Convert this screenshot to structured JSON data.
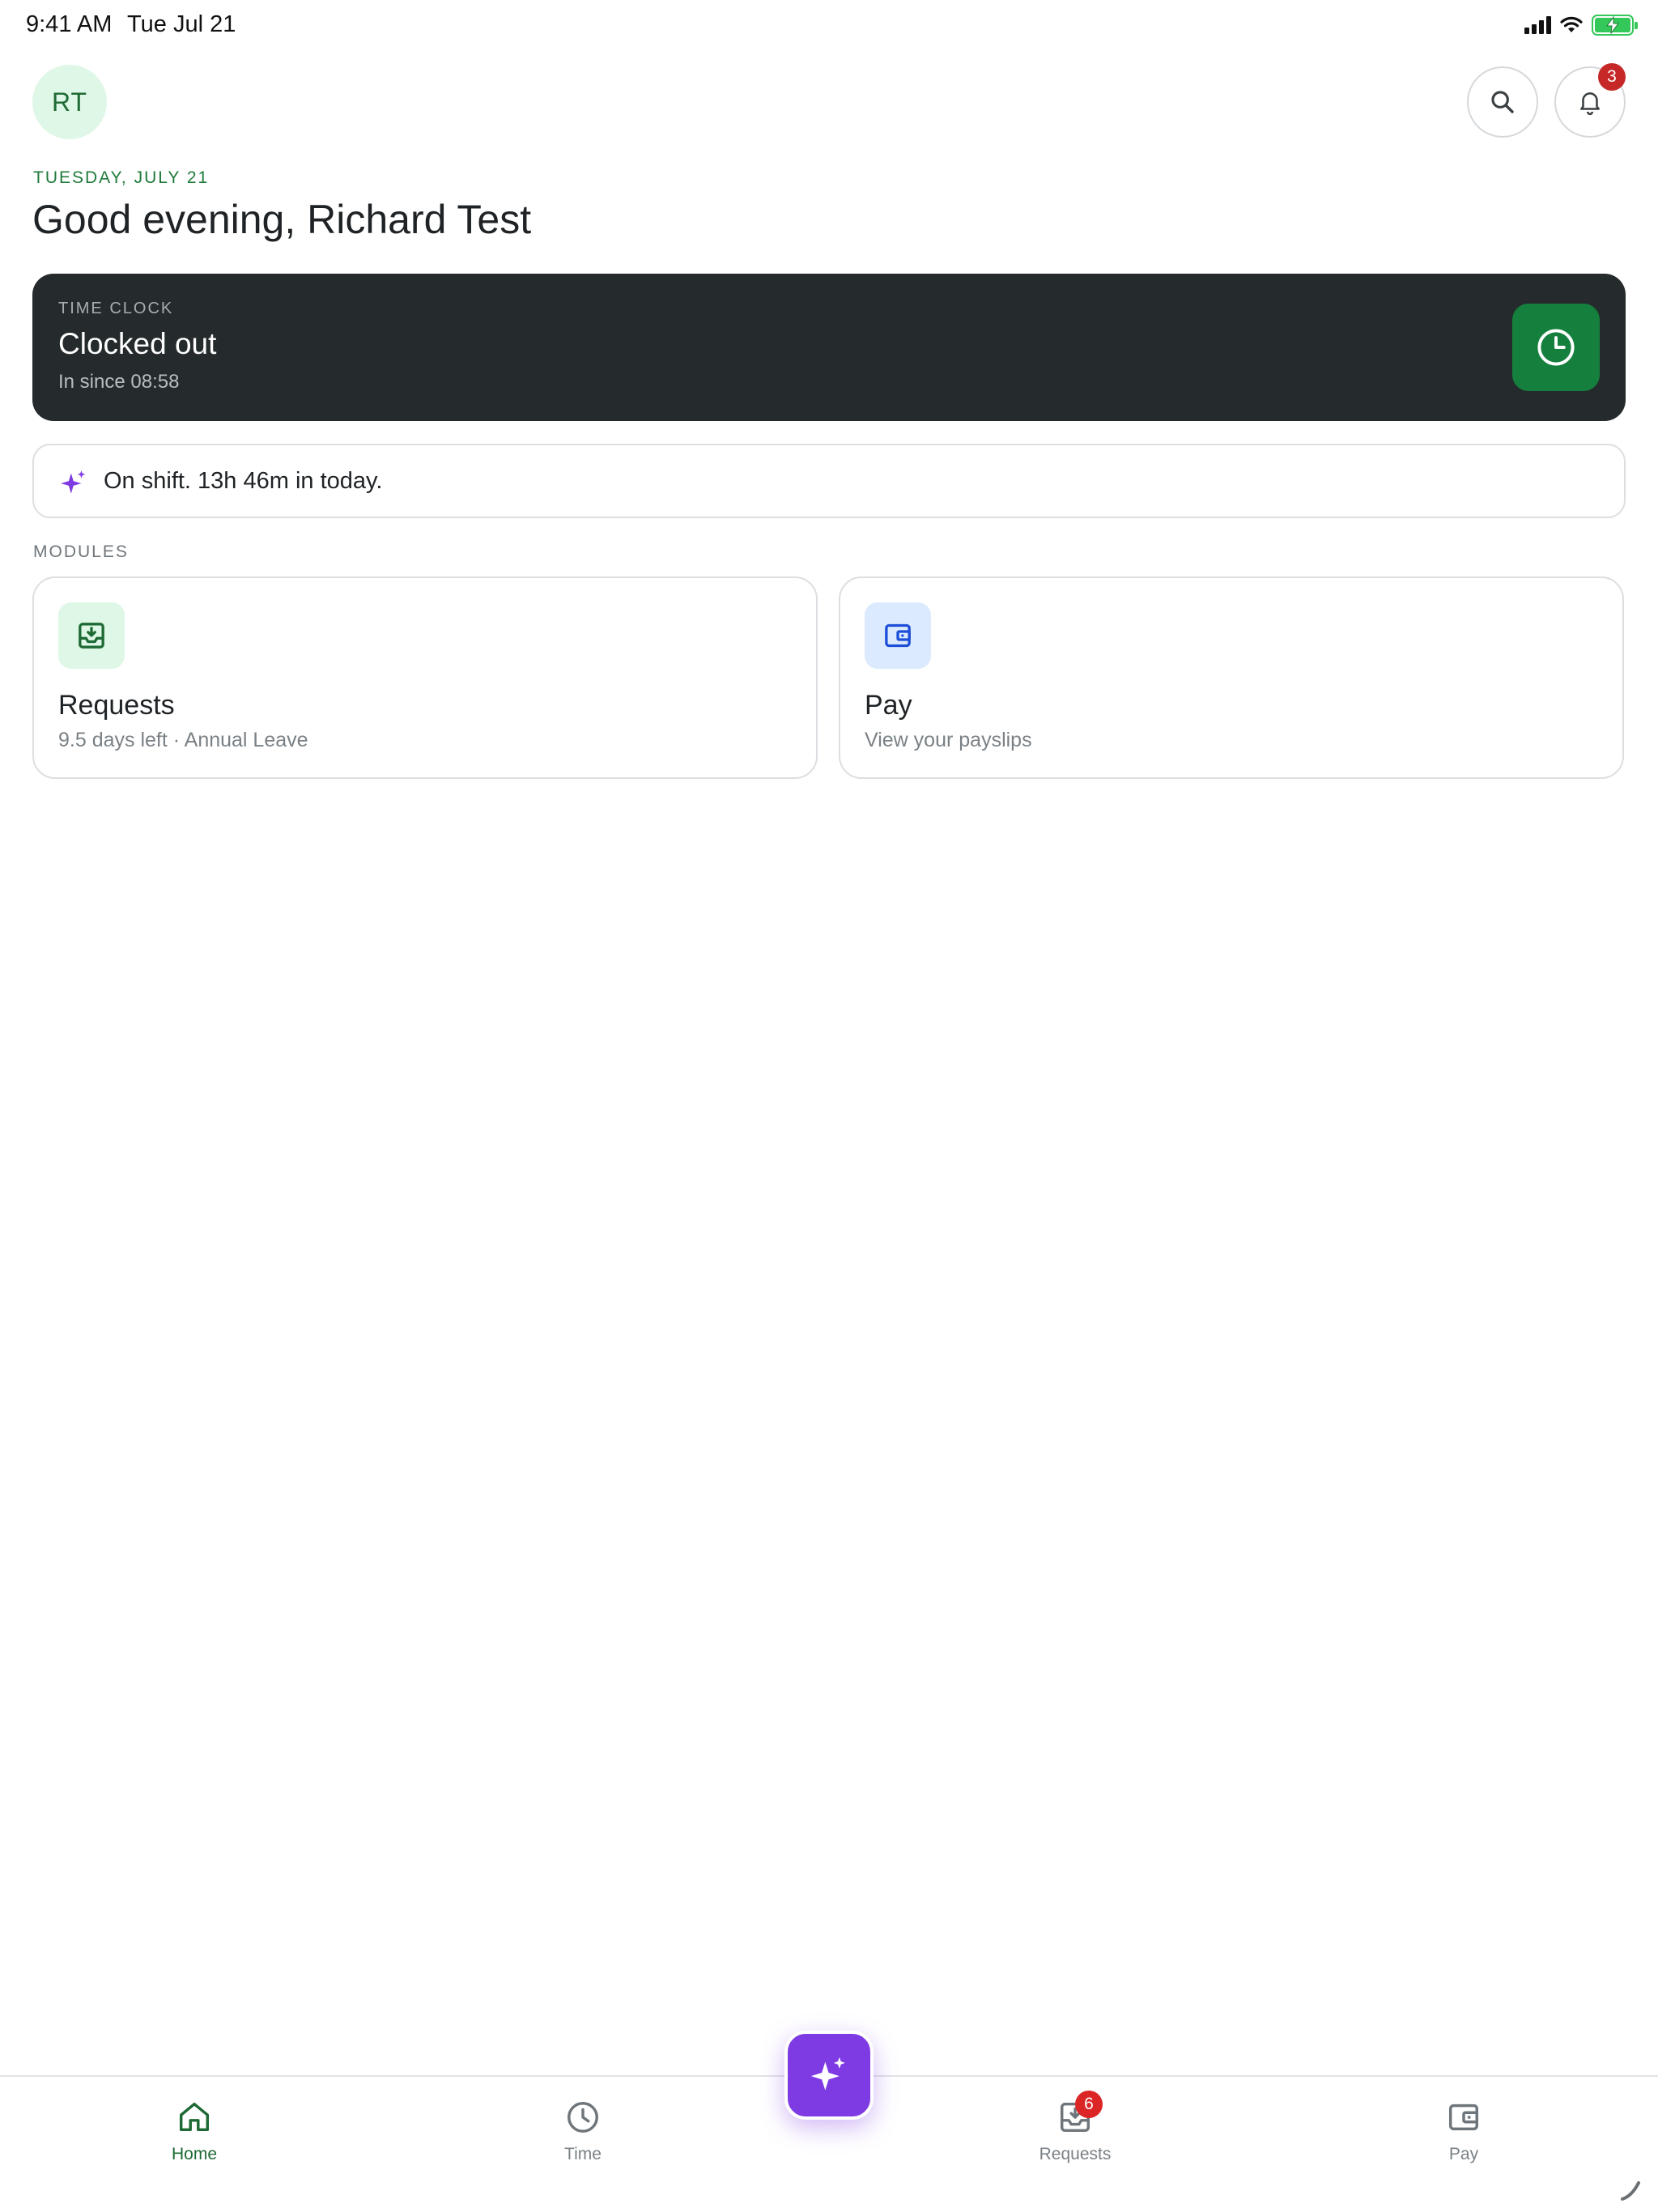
{
  "status_bar": {
    "time": "9:41 AM",
    "date": "Tue Jul 21"
  },
  "header": {
    "avatar_initials": "RT",
    "notification_count": "3",
    "date_caption": "TUESDAY, JULY 21",
    "greeting": "Good evening, Richard Test"
  },
  "time_clock": {
    "label": "TIME CLOCK",
    "status": "Clocked out",
    "since": "In since 08:58",
    "action_icon": "clock-icon"
  },
  "shift_banner": {
    "text": "On shift. 13h 46m in today.",
    "icon": "sparkles-icon"
  },
  "modules": {
    "label": "MODULES",
    "items": [
      {
        "title": "Requests",
        "subtitle": "9.5 days left · Annual Leave",
        "icon": "inbox-download-icon"
      },
      {
        "title": "Pay",
        "subtitle": "View your payslips",
        "icon": "wallet-icon"
      }
    ]
  },
  "tabbar": {
    "items": [
      {
        "label": "Home",
        "icon": "home-icon",
        "active": true
      },
      {
        "label": "Time",
        "icon": "clock-icon",
        "active": false
      },
      {
        "label": "Requests",
        "icon": "inbox-icon",
        "active": false,
        "badge": "6"
      },
      {
        "label": "Pay",
        "icon": "wallet-icon",
        "active": false
      }
    ],
    "fab_icon": "sparkles-icon"
  },
  "colors": {
    "accent_green": "#15803d",
    "dark_card": "#252a2c",
    "purple": "#7e3ae3",
    "badge_red": "#c62828"
  }
}
